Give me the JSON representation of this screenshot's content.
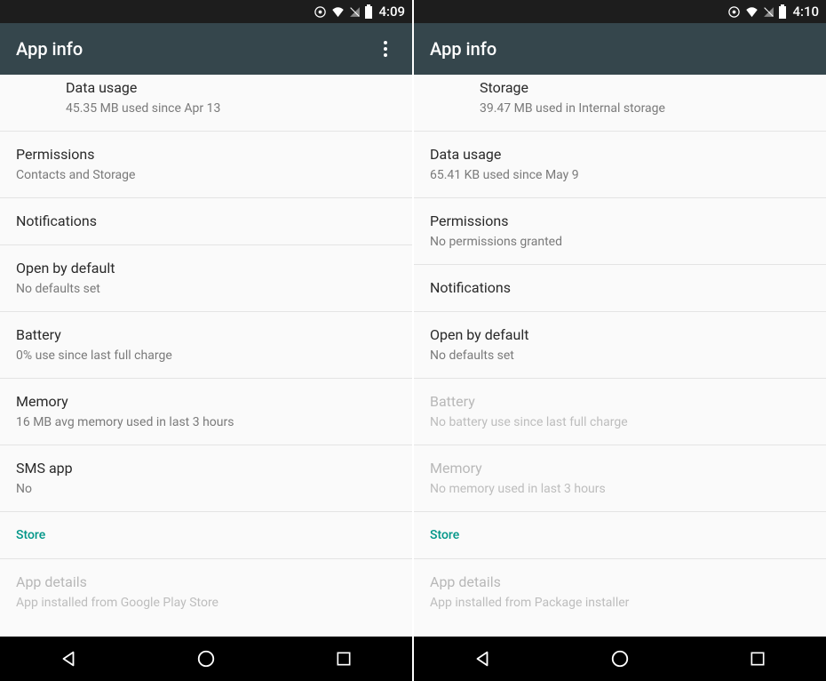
{
  "left": {
    "status": {
      "time": "4:09"
    },
    "appbar": {
      "title": "App info",
      "has_overflow": true
    },
    "rows": [
      {
        "primary": "Data usage",
        "secondary": "45.35 MB used since Apr 13",
        "partial": true
      },
      {
        "primary": "Permissions",
        "secondary": "Contacts and Storage"
      },
      {
        "primary": "Notifications"
      },
      {
        "primary": "Open by default",
        "secondary": "No defaults set"
      },
      {
        "primary": "Battery",
        "secondary": "0% use since last full charge"
      },
      {
        "primary": "Memory",
        "secondary": "16 MB avg memory used in last 3 hours"
      },
      {
        "primary": "SMS app",
        "secondary": "No"
      },
      {
        "primary": "Store",
        "section": true
      },
      {
        "primary": "App details",
        "secondary": "App installed from Google Play Store",
        "fade": true
      }
    ]
  },
  "right": {
    "status": {
      "time": "4:10"
    },
    "appbar": {
      "title": "App info",
      "has_overflow": false
    },
    "rows": [
      {
        "primary": "Storage",
        "secondary": "39.47 MB used in Internal storage",
        "partial": true
      },
      {
        "primary": "Data usage",
        "secondary": "65.41 KB used since May 9"
      },
      {
        "primary": "Permissions",
        "secondary": "No permissions granted"
      },
      {
        "primary": "Notifications"
      },
      {
        "primary": "Open by default",
        "secondary": "No defaults set"
      },
      {
        "primary": "Battery",
        "secondary": "No battery use since last full charge",
        "disabled": true
      },
      {
        "primary": "Memory",
        "secondary": "No memory used in last 3 hours",
        "disabled": true
      },
      {
        "primary": "Store",
        "section": true
      },
      {
        "primary": "App details",
        "secondary": "App installed from Package installer",
        "fade": true
      }
    ]
  },
  "icons": {
    "sync": "sync-icon",
    "wifi": "wifi-icon",
    "nosim": "no-sim-icon",
    "battery": "battery-icon"
  }
}
